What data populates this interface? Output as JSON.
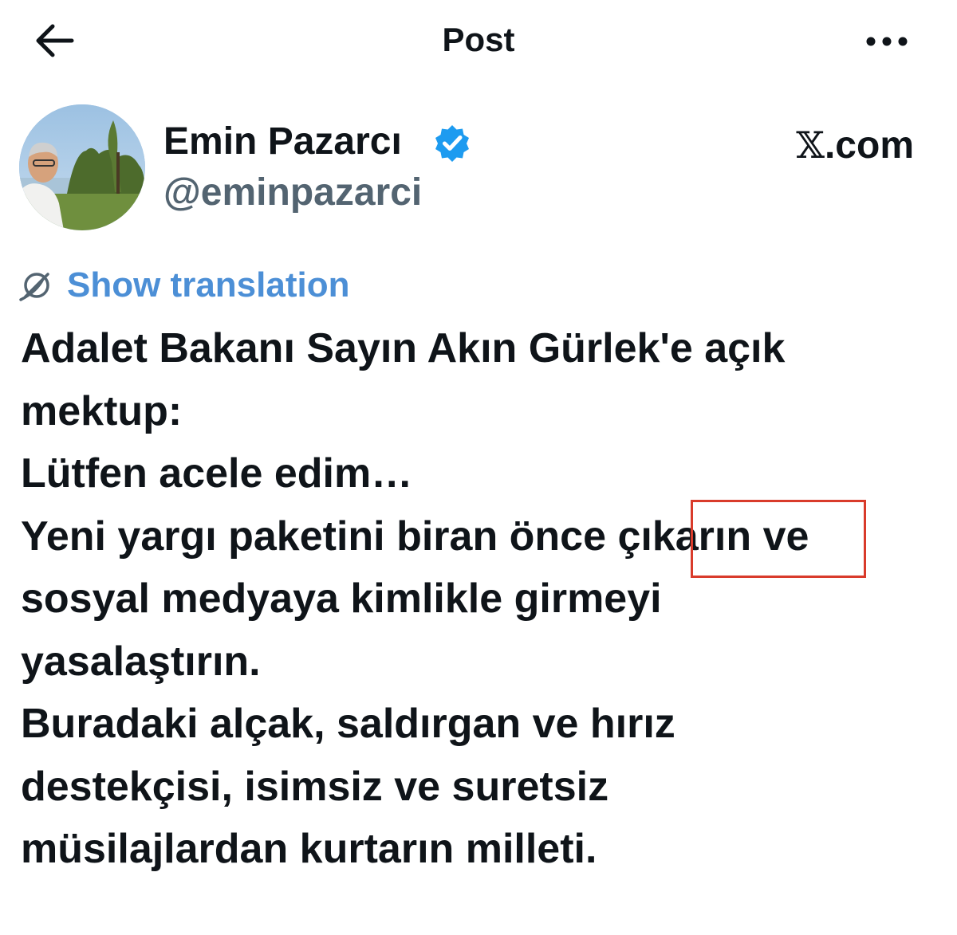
{
  "header": {
    "title": "Post",
    "back_icon": "arrow-left-icon",
    "more_icon": "more-horizontal-icon"
  },
  "author": {
    "name": "Emin Pazarcı",
    "handle": "@eminpazarci",
    "verified": true,
    "verified_color": "#1d9bf0"
  },
  "site_logo": {
    "glyph": "𝕏",
    "suffix": ".com"
  },
  "translation": {
    "label": "Show translation",
    "color": "#4c8fd6",
    "icon": "globe-icon"
  },
  "tweet": {
    "lines": [
      "Adalet Bakanı Sayın Akın Gürlek'e açık",
      "mektup:",
      "Lütfen acele edim…",
      "Yeni yargı paketini biran önce çıkarın ve",
      "sosyal medyaya kimlikle girmeyi",
      "yasalaştırın.",
      "Buradaki alçak, saldırgan ve hırız",
      "destekçisi, isimsiz ve suretsiz",
      "müsilajlardan kurtarın milleti."
    ],
    "highlighted_word": "çıkarın",
    "highlight_color": "#d93b2b"
  }
}
